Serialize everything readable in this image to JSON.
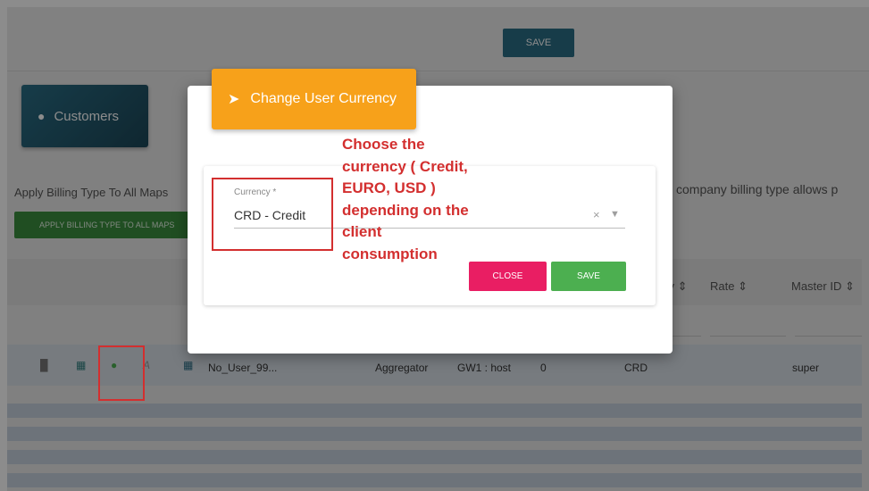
{
  "toolbar": {
    "save_label": "SAVE"
  },
  "customers_card": {
    "icon": "user-icon",
    "label": "Customers"
  },
  "billing": {
    "apply_text": "Apply Billing Type To All Maps",
    "apply_button": "APPLY BILLING TYPE TO ALL MAPS",
    "right_text": "company billing type allows p"
  },
  "table": {
    "headers": {
      "currency": "cy ⇕",
      "rate": "Rate ⇕",
      "master_id": "Master ID ⇕"
    },
    "row": {
      "name": "No_User_99...",
      "type": "Aggregator",
      "gateway": "GW1 : host",
      "count": "0",
      "currency": "CRD",
      "master": "super"
    }
  },
  "dialog": {
    "tab_title": "Change User Currency",
    "field_label": "Currency *",
    "field_value": "CRD - Credit",
    "close_label": "CLOSE",
    "save_label": "SAVE"
  },
  "annotation": {
    "lines": [
      "Choose the",
      "currency ( Credit,",
      "EURO, USD )",
      "depending on the",
      "client",
      "consumption"
    ]
  },
  "colors": {
    "accent_orange": "#f7a11a",
    "close_pink": "#e91e63",
    "save_green": "#4caf50",
    "annotation_red": "#d32f2f"
  }
}
